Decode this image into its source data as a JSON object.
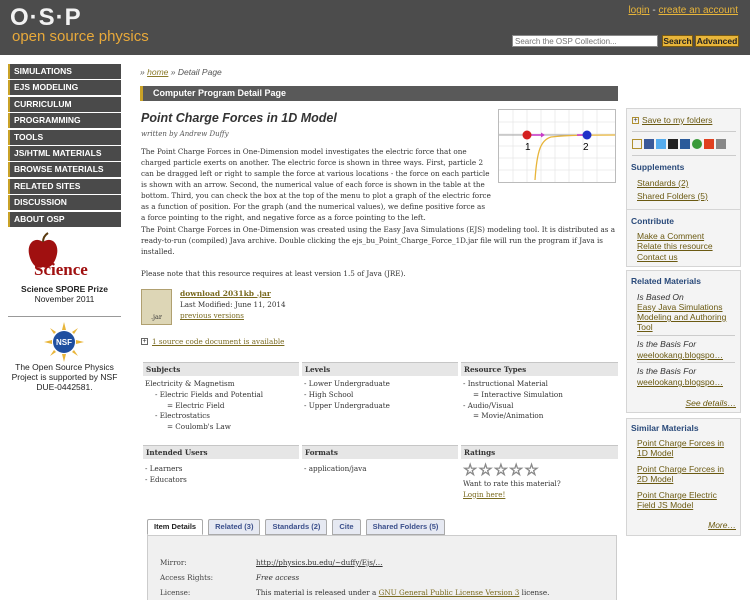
{
  "header": {
    "logo_top": "O·S·P",
    "logo_sub": "open source physics",
    "login": "login",
    "sep": "-",
    "create_account": "create an account",
    "search_placeholder": "Search the OSP Collection...",
    "search_button": "Search",
    "advanced_button": "Advanced"
  },
  "nav": [
    "SIMULATIONS",
    "EJS MODELING",
    "CURRICULUM",
    "PROGRAMMING",
    "TOOLS",
    "JS/HTML MATERIALS",
    "BROWSE MATERIALS",
    "RELATED SITES",
    "DISCUSSION",
    "ABOUT OSP"
  ],
  "spore": {
    "logo": "Science",
    "prize": "Science SPORE Prize",
    "date": "November 2011"
  },
  "nsf": {
    "badge": "NSF",
    "text": "The Open Source Physics Project is supported by NSF DUE-0442581."
  },
  "breadcrumb": {
    "prefix": "»",
    "home": "home",
    "current": "» Detail Page"
  },
  "page_bar": "Computer Program Detail Page",
  "resource": {
    "title": "Point Charge Forces in 1D Model",
    "author": "written by Andrew Duffy",
    "desc1": "The Point Charge Forces in One-Dimension model investigates the electric force that one charged particle exerts on another.  The electric force is shown in three ways. First, particle 2 can be dragged left or right to sample the force at various locations - the force on each particle is shown with an arrow. Second, the numerical value of each force is shown in the table at the bottom. Third, you can check the box at the top of the menu to plot a graph of the electric force as a function of position. For the graph (and the numerical values), we define positive force as a force pointing to the right, and negative force as a force pointing to the left.",
    "desc2": "The Point Charge Forces in One-Dimension was created using the Easy Java Simulations (EJS) modeling tool.  It is distributed as a ready-to-run (compiled) Java archive.  Double clicking the ejs_bu_Point_Charge_Force_1D.jar file will run the program if Java is installed.",
    "desc3": "Please note that this resource requires at least version 1.5 of Java (JRE).",
    "sim_label_1": "1",
    "sim_label_2": "2",
    "download": "download 2031kb .jar",
    "file_icon": ".jar",
    "last_modified": "Last Modified: June 11, 2014",
    "previous": "previous versions",
    "source_doc": "1 source code document is available",
    "plus_icon": "+"
  },
  "table": {
    "subjects_h": "Subjects",
    "levels_h": "Levels",
    "types_h": "Resource Types",
    "subjects": [
      "Electricity & Magnetism",
      "- Electric Fields and Potential",
      "= Electric Field",
      "- Electrostatics",
      "= Coulomb's Law"
    ],
    "levels": [
      "- Lower Undergraduate",
      "- High School",
      "- Upper Undergraduate"
    ],
    "types": [
      "- Instructional Material",
      "= Interactive Simulation",
      "- Audio/Visual",
      "= Movie/Animation"
    ],
    "users_h": "Intended Users",
    "formats_h": "Formats",
    "ratings_h": "Ratings",
    "users": [
      "- Learners",
      "- Educators"
    ],
    "formats": [
      "- application/java"
    ],
    "stars": [
      "☆",
      "☆",
      "☆",
      "☆",
      "☆"
    ],
    "rate_q": "Want to rate this material?",
    "login": "Login here!"
  },
  "tabs": [
    "Item Details",
    "Related (3)",
    "Standards (2)",
    "Cite",
    "Shared Folders (5)"
  ],
  "details": {
    "mirror_l": "Mirror:",
    "mirror_v": "http://physics.bu.edu/~duffy/Ejs/…",
    "access_l": "Access Rights:",
    "access_v": "Free access",
    "license_l": "License:",
    "license_pre": "This material is released under a",
    "license_link": "GNU General Public License Version 3",
    "license_post": "license."
  },
  "sidebar": {
    "save": "Save to my folders",
    "share_icons": [
      "plus-icon",
      "facebook-icon",
      "twitter-icon",
      "delicious-icon",
      "digg-icon",
      "stumbleupon-icon",
      "google-icon",
      "email-icon"
    ],
    "supplements_h": "Supplements",
    "standards": "Standards (2)",
    "shared": "Shared Folders (5)",
    "contribute_h": "Contribute",
    "make_comment": "Make a Comment",
    "relate": "Relate this resource",
    "contact": "Contact us",
    "related_h": "Related Materials",
    "based_on": "Is Based On",
    "based_link": "Easy Java Simulations Modeling and Authoring Tool",
    "basis1": "Is the Basis For",
    "basis1_link": "weelookang.blogspo…",
    "basis2": "Is the Basis For",
    "basis2_link": "weelookang.blogspo…",
    "see_details": "See details…",
    "similar_h": "Similar Materials",
    "sim1": "Point Charge Forces in 1D Model",
    "sim2": "Point Charge Forces in 2D Model",
    "sim3": "Point Charge Electric Field JS Model",
    "more": "More…"
  },
  "colors": {
    "header_bg": "#4c4c4c",
    "accent": "#e8b53a",
    "nav_bg": "#4a4a4a",
    "link": "#7a6a1f"
  }
}
